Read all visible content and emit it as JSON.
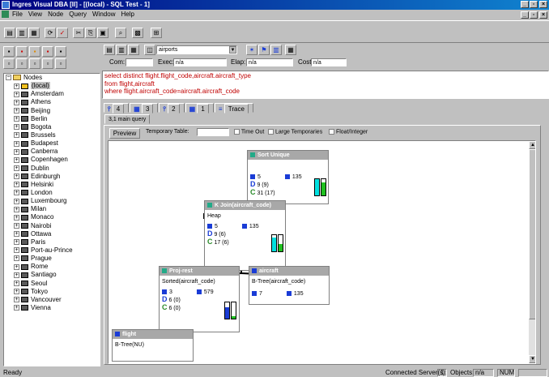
{
  "window": {
    "title": "Ingres Visual DBA [II] - [(local) - SQL Test - 1]"
  },
  "menu": [
    "File",
    "View",
    "Node",
    "Query",
    "Window",
    "Help"
  ],
  "query_toolbar": {
    "database": "airports"
  },
  "stats_bar": {
    "com_label": "Com:",
    "com_value": "",
    "exec_label": "Exec:",
    "exec_value": "n/a",
    "elap_label": "Elap:",
    "elap_value": "n/a",
    "cost_label": "Cost:",
    "cost_value": "n/a"
  },
  "sql": {
    "line1": "select distinct flight.flight_code,aircraft.aircraft_type",
    "line2": "from flight,aircraft",
    "line3": "where flight.aircraft_code=aircraft.aircraft_code"
  },
  "result_tabs": [
    "4",
    "3",
    "2",
    "1",
    "Trace"
  ],
  "sub_tab": "3,1  main query",
  "preview_bar": {
    "preview": "Preview",
    "temp_table_label": "Temporary Table:",
    "time_out": "Time Out",
    "large_temporaries": "Large Temporaries",
    "float_integer": "Float/Integer"
  },
  "tree": {
    "root": "Nodes",
    "local": "(local)",
    "nodes": [
      "Amsterdam",
      "Athens",
      "Beijing",
      "Berlin",
      "Bogota",
      "Brussels",
      "Budapest",
      "Canberra",
      "Copenhagen",
      "Dublin",
      "Edinburgh",
      "Helsinki",
      "London",
      "Luxembourg",
      "Milan",
      "Monaco",
      "Nairobi",
      "Ottawa",
      "Paris",
      "Port-au-Prince",
      "Prague",
      "Rome",
      "Santiago",
      "Seoul",
      "Tokyo",
      "Vancouver",
      "Vienna"
    ]
  },
  "plan": {
    "sort": {
      "title": "Sort Unique",
      "a": "5",
      "b": "135",
      "d": "9 (9)",
      "c": "31 (17)"
    },
    "join": {
      "title": "K Join(aircraft_code)",
      "sub": "Heap",
      "a": "5",
      "b": "135",
      "d": "9 (6)",
      "c": "17 (6)"
    },
    "proj": {
      "title": "Proj-rest",
      "sub": "Sorted(aircraft_code)",
      "a": "3",
      "b": "579",
      "d": "6 (0)",
      "c": "6 (0)"
    },
    "aircraft": {
      "title": "aircraft",
      "sub": "B-Tree(aircraft_code)",
      "a": "7",
      "b": "135"
    },
    "flight": {
      "title": "flight",
      "sub": "B-Tree(NU)"
    }
  },
  "status": {
    "left": "Ready",
    "servers_label": "Connected Server(s):",
    "servers": "1",
    "objects_label": "Objects:",
    "objects": "n/a",
    "num": "NUM"
  }
}
